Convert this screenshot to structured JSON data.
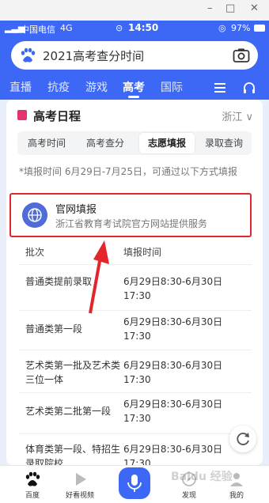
{
  "window": {
    "minimize": "–",
    "maximize": "□",
    "close": "✕"
  },
  "status": {
    "carrier": "中国电信",
    "network": "4G",
    "time": "14:50",
    "battery": "97%"
  },
  "search": {
    "value": "2021高考查分时间"
  },
  "channels": [
    "直播",
    "抗疫",
    "游戏",
    "高考",
    "国际"
  ],
  "card": {
    "title": "高考日程",
    "region": "浙江",
    "tabs": [
      "高考时间",
      "高考查分",
      "志愿填报",
      "录取查询"
    ],
    "notice": "*填报时间 6月29日-7月25日，可通过以下方式填报",
    "official": {
      "title": "官网填报",
      "subtitle": "浙江省教育考试院官方网站提供服务"
    },
    "table": {
      "headers": [
        "批次",
        "填报时间"
      ],
      "rows": [
        {
          "name": "普通类提前录取",
          "time": "6月29日8:30-6月30日17:30"
        },
        {
          "name": "普通类第一段",
          "time": "6月29日8:30-6月30日17:30"
        },
        {
          "name": "艺术类第一批及艺术类三位一体",
          "time": "6月29日8:30-6月30日17:30"
        },
        {
          "name": "艺术类第二批第一段",
          "time": "6月29日8:30-6月30日17:30"
        },
        {
          "name": "体育类第一段、特招生录取院校",
          "time": "6月29日8:30-6月30日17:30"
        }
      ]
    }
  },
  "bottom_nav": {
    "home": "百度",
    "video": "好看视频",
    "discover": "发现",
    "mine": "我的"
  },
  "watermark": "Baidu 经验",
  "colors": {
    "brand": "#3d68f5",
    "highlight": "#e3262b",
    "calendar": "#e2336a"
  }
}
